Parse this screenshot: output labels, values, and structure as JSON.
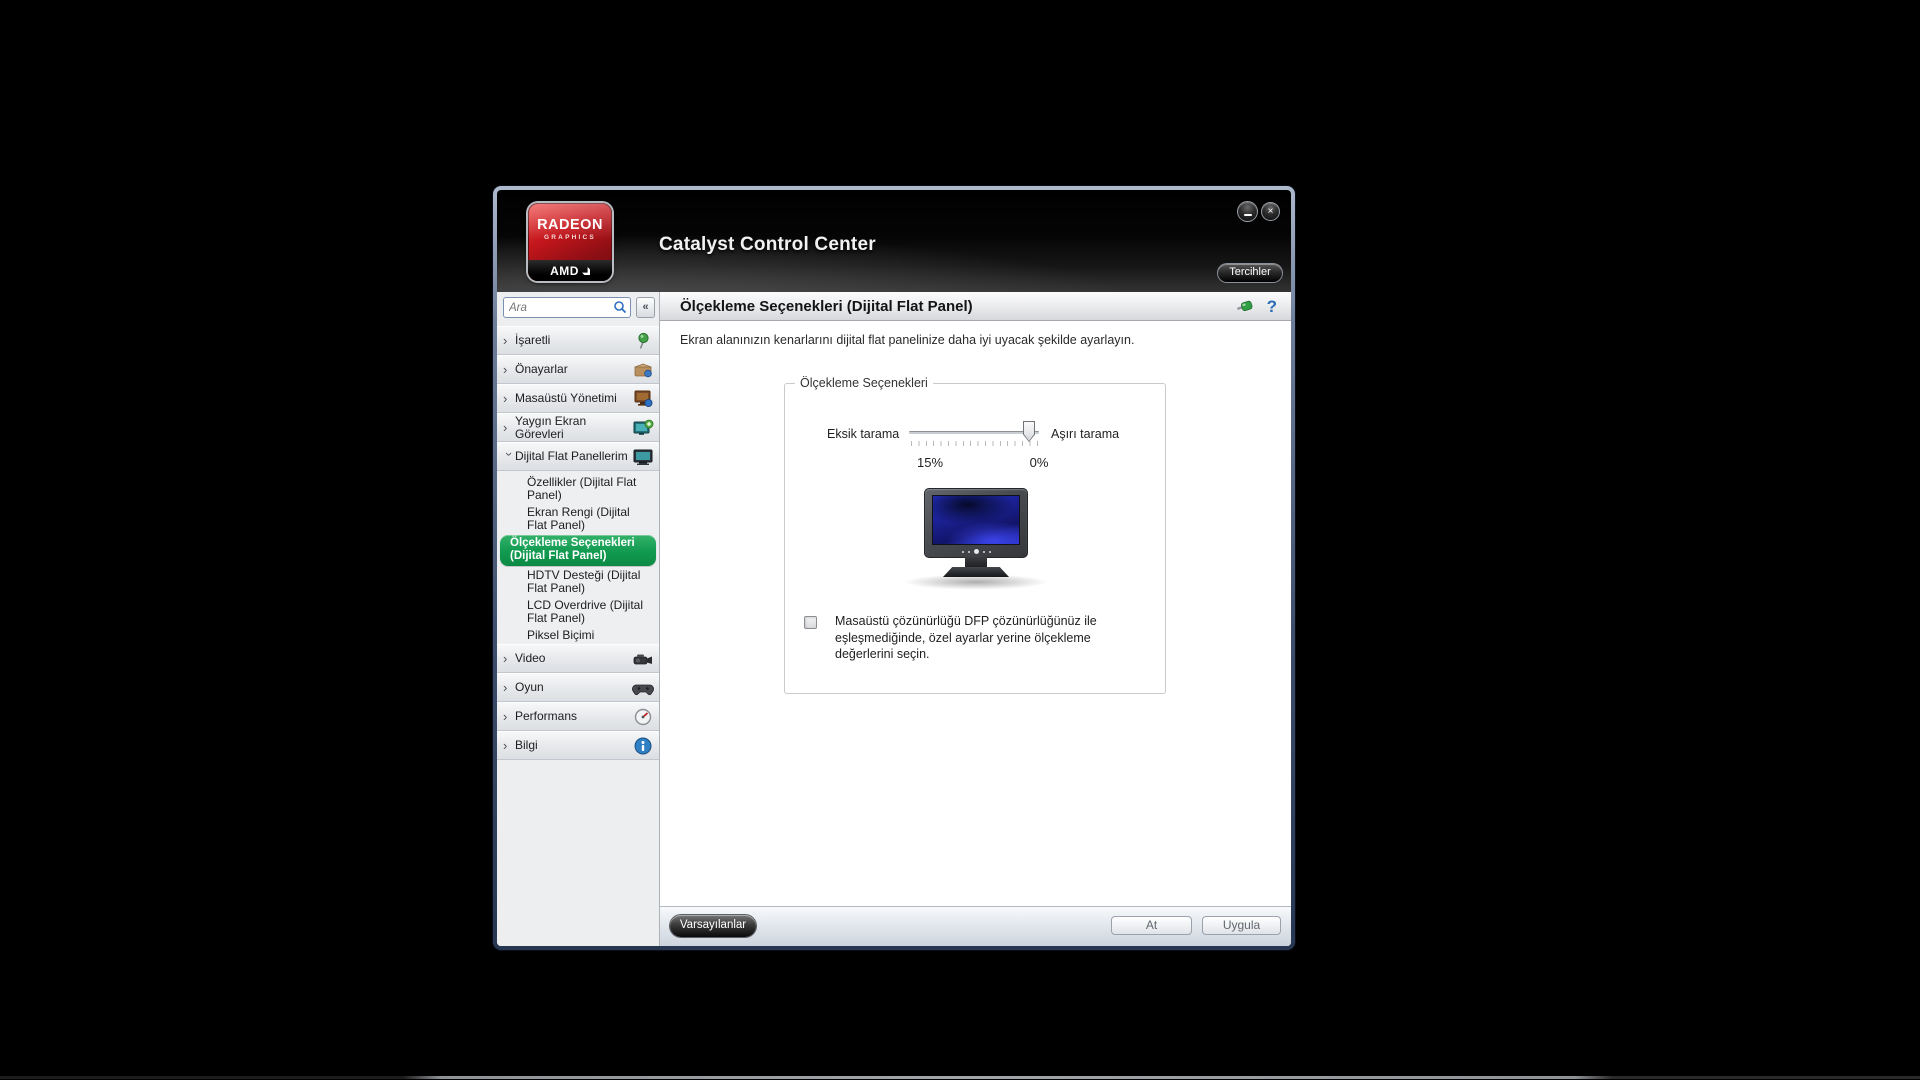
{
  "window": {
    "title": "Catalyst Control Center",
    "logo": {
      "line1": "RADEON",
      "line2": "GRAPHICS",
      "brand": "AMD"
    },
    "controls": {
      "close_glyph": "×"
    },
    "preferences_button": "Tercihler"
  },
  "sidebar": {
    "search": {
      "placeholder": "Ara",
      "collapse_glyph": "«"
    },
    "items": [
      {
        "label": "İşaretli",
        "icon": "pushpin-icon",
        "level": 1
      },
      {
        "label": "Önayarlar",
        "icon": "presets-icon",
        "level": 1
      },
      {
        "label": "Masaüstü Yönetimi",
        "icon": "desktop-management-icon",
        "level": 1
      },
      {
        "label": "Yaygın Ekran Görevleri",
        "icon": "display-tasks-icon",
        "level": 1
      },
      {
        "label": "Dijital Flat Panellerim",
        "icon": "flat-panel-icon",
        "level": 1,
        "expanded": true
      },
      {
        "label": "Özellikler (Dijital Flat Panel)",
        "level": 2
      },
      {
        "label": "Ekran Rengi (Dijital Flat Panel)",
        "level": 2
      },
      {
        "label": "Ölçekleme Seçenekleri (Dijital Flat Panel)",
        "level": 2,
        "selected": true
      },
      {
        "label": "HDTV Desteği (Dijital Flat Panel)",
        "level": 2
      },
      {
        "label": "LCD Overdrive (Dijital Flat Panel)",
        "level": 2
      },
      {
        "label": "Piksel Biçimi",
        "level": 2
      },
      {
        "label": "Video",
        "icon": "video-camera-icon",
        "level": 1
      },
      {
        "label": "Oyun",
        "icon": "gamepad-icon",
        "level": 1
      },
      {
        "label": "Performans",
        "icon": "gauge-icon",
        "level": 1
      },
      {
        "label": "Bilgi",
        "icon": "info-icon",
        "level": 1
      }
    ]
  },
  "content": {
    "header": {
      "title": "Ölçekleme Seçenekleri (Dijital Flat Panel)",
      "help_glyph": "?"
    },
    "description": "Ekran alanınızın kenarlarını dijital flat panelinize daha iyi uyacak şekilde ayarlayın.",
    "groupbox": {
      "legend": "Ölçekleme Seçenekleri",
      "slider": {
        "left_label": "Eksik tarama",
        "right_label": "Aşırı tarama",
        "left_value": "15%",
        "right_value": "0%",
        "thumb_position": "right-end"
      },
      "checkbox": {
        "checked": false,
        "label": "Masaüstü çözünürlüğü DFP çözünürlüğünüz ile eşleşmediğinde, özel ayarlar yerine ölçekleme değerlerini seçin."
      }
    },
    "footer": {
      "defaults": "Varsayılanlar",
      "discard": "At",
      "apply": "Uygula"
    }
  },
  "colors": {
    "selection_green": "#119A50",
    "radeon_red": "#C3161C",
    "help_blue": "#2A6CB5",
    "header_black": "#000000",
    "sidebar_gray": "#ECEEF0"
  }
}
